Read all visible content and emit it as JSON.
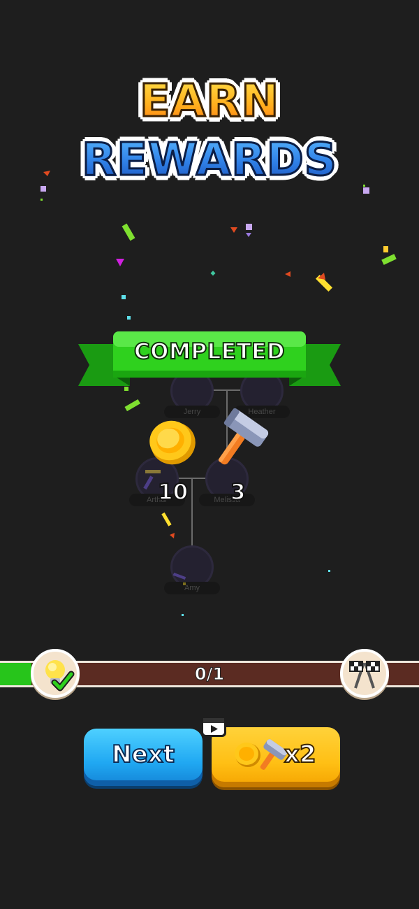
{
  "title": {
    "line1": "EARN",
    "line2": "REWARDS"
  },
  "banner": {
    "label": "COMPLETED"
  },
  "tree": {
    "nodes": [
      {
        "name": "Jerry"
      },
      {
        "name": "Heather"
      },
      {
        "name": "Arthur"
      },
      {
        "name": "Melissa"
      },
      {
        "name": "Amy"
      }
    ]
  },
  "rewards": [
    {
      "icon": "coin-icon",
      "count": "10"
    },
    {
      "icon": "hammer-icon",
      "count": "3"
    }
  ],
  "progress": {
    "text": "0/1",
    "value": 0.075,
    "start_icon": "lightbulb-check-icon",
    "end_icon": "checkered-flags-icon"
  },
  "buttons": {
    "next": {
      "label": "Next"
    },
    "multiply": {
      "label": "x2",
      "badge_icon": "video-ad-icon"
    }
  },
  "colors": {
    "background": "#1e1e1e",
    "ribbon_green": "#2fd11e",
    "next_blue": "#20a8f2",
    "x2_yellow": "#ffbf14",
    "progress_green": "#27c51b",
    "progress_track": "#5b2b22"
  }
}
